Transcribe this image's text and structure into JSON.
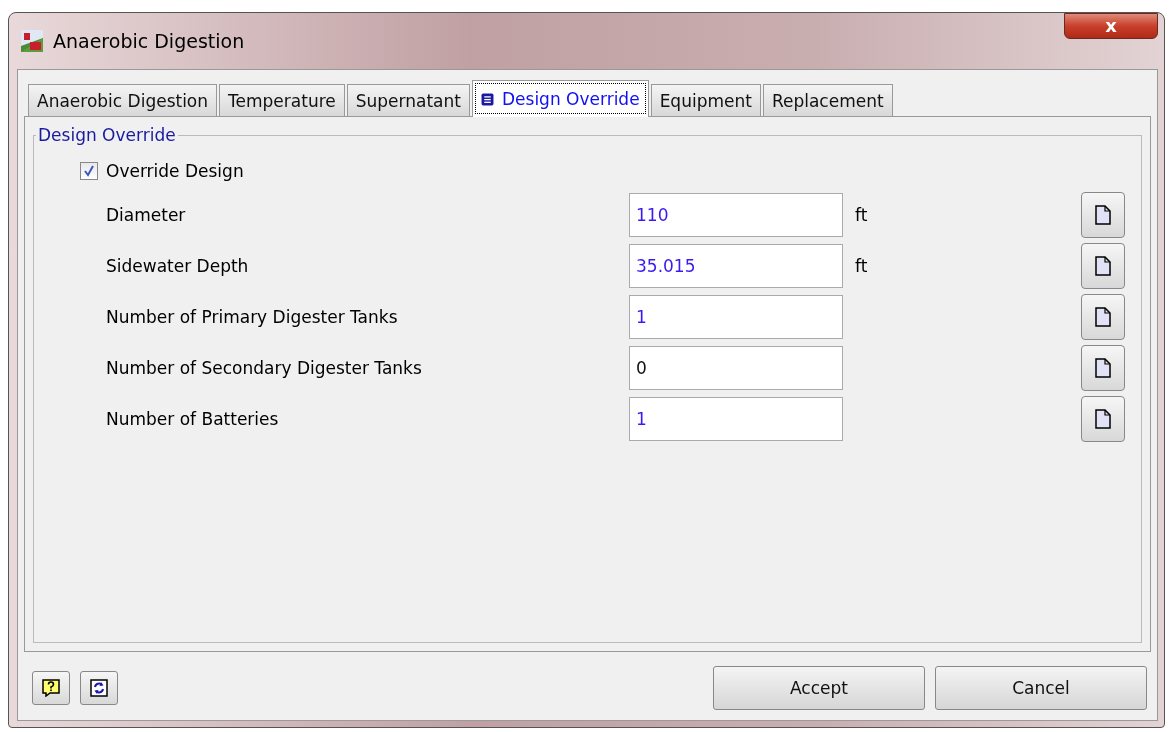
{
  "window": {
    "title": "Anaerobic Digestion",
    "close": "x"
  },
  "tabs": [
    {
      "label": "Anaerobic Digestion",
      "selected": false
    },
    {
      "label": "Temperature",
      "selected": false
    },
    {
      "label": "Supernatant",
      "selected": false
    },
    {
      "label": "Design Override",
      "selected": true
    },
    {
      "label": "Equipment",
      "selected": false
    },
    {
      "label": "Replacement",
      "selected": false
    }
  ],
  "group": {
    "title": "Design Override",
    "override": {
      "label": "Override Design",
      "checked": true
    },
    "fields": [
      {
        "label": "Diameter",
        "value": "110",
        "unit": "ft",
        "overridden": true
      },
      {
        "label": "Sidewater Depth",
        "value": "35.015",
        "unit": "ft",
        "overridden": true
      },
      {
        "label": "Number of Primary Digester Tanks",
        "value": "1",
        "overridden": true
      },
      {
        "label": "Number of Secondary Digester Tanks",
        "value": "0",
        "overridden": false
      },
      {
        "label": "Number of Batteries",
        "value": "1",
        "overridden": true
      }
    ]
  },
  "buttons": [
    "Accept",
    "Cancel"
  ]
}
